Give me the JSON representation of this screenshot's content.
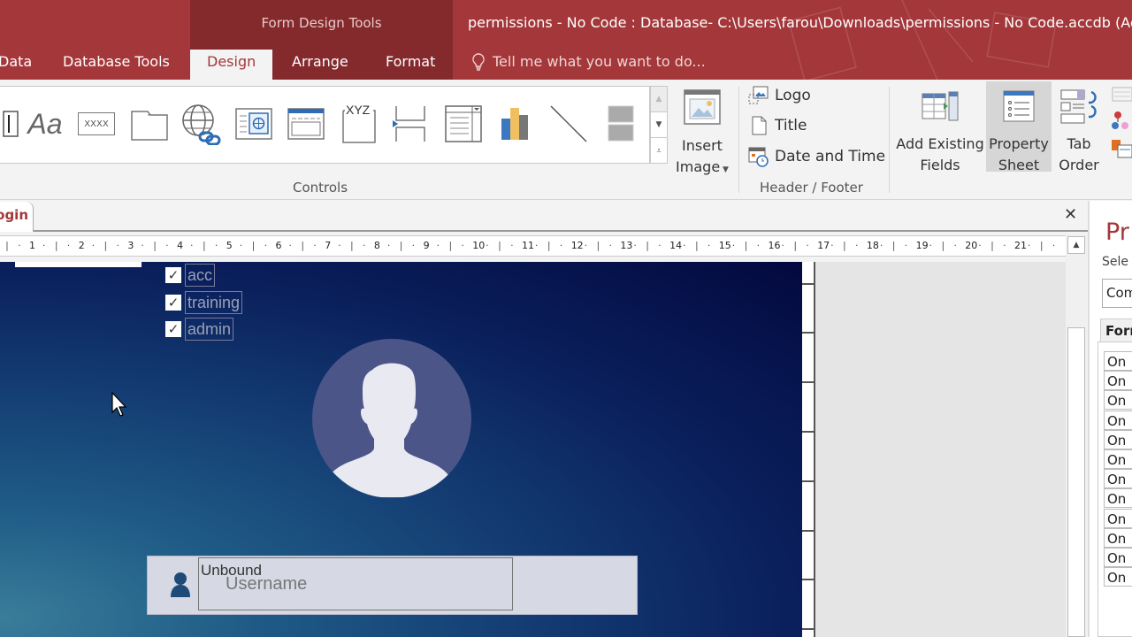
{
  "window": {
    "context_title": "Form Design Tools",
    "title": "permissions - No Code : Database- C:\\Users\\farou\\Downloads\\permissions - No Code.accdb (Ac"
  },
  "tabs": [
    {
      "label": "Data",
      "active": false
    },
    {
      "label": "Database Tools",
      "active": false
    },
    {
      "label": "Design",
      "active": true
    },
    {
      "label": "Arrange",
      "active": false
    },
    {
      "label": "Format",
      "active": false
    }
  ],
  "tell_me": {
    "placeholder": "Tell me what you want to do..."
  },
  "ribbon": {
    "controls_group_label": "Controls",
    "controls": [
      {
        "name": "textbox-control",
        "label": ""
      },
      {
        "name": "label-control",
        "label": "Aa"
      },
      {
        "name": "button-control",
        "label": "XXXX"
      },
      {
        "name": "tab-control",
        "label": ""
      },
      {
        "name": "hyperlink-control",
        "label": ""
      },
      {
        "name": "web-browser-control",
        "label": ""
      },
      {
        "name": "navigation-control",
        "label": ""
      },
      {
        "name": "option-group-control",
        "label": "XYZ"
      },
      {
        "name": "page-break-control",
        "label": ""
      },
      {
        "name": "combo-box-control",
        "label": ""
      },
      {
        "name": "chart-control",
        "label": ""
      },
      {
        "name": "line-control",
        "label": ""
      },
      {
        "name": "toggle-button-control",
        "label": ""
      }
    ],
    "insert_image": {
      "line1": "Insert",
      "line2": "Image"
    },
    "header_footer": {
      "group_label": "Header / Footer",
      "logo": "Logo",
      "title": "Title",
      "date_time": "Date and Time"
    },
    "tools": {
      "add_existing_fields": {
        "line1": "Add Existing",
        "line2": "Fields"
      },
      "property_sheet": {
        "line1": "Property",
        "line2": "Sheet",
        "active": true
      },
      "tab_order": {
        "line1": "Tab",
        "line2": "Order"
      }
    }
  },
  "document": {
    "tab_label": "Login",
    "ruler_marks": [
      "1",
      "2",
      "3",
      "4",
      "5",
      "6",
      "7",
      "8",
      "9",
      "10",
      "11",
      "12",
      "13",
      "14",
      "15",
      "16",
      "17",
      "18",
      "19",
      "20",
      "21"
    ]
  },
  "form": {
    "checkboxes": [
      {
        "label": "acc",
        "checked": true
      },
      {
        "label": "training",
        "checked": true
      },
      {
        "label": "admin",
        "checked": true
      }
    ],
    "username_field": {
      "value": "Unbound",
      "placeholder": "Username"
    }
  },
  "property_sheet": {
    "title": "Pr",
    "selection_label": "Sele",
    "selection_value": "Com",
    "tab_label": "Form",
    "rows": [
      "On",
      "On",
      "On",
      "On",
      "On",
      "On",
      "On",
      "On",
      "On",
      "On",
      "On",
      "On"
    ]
  }
}
